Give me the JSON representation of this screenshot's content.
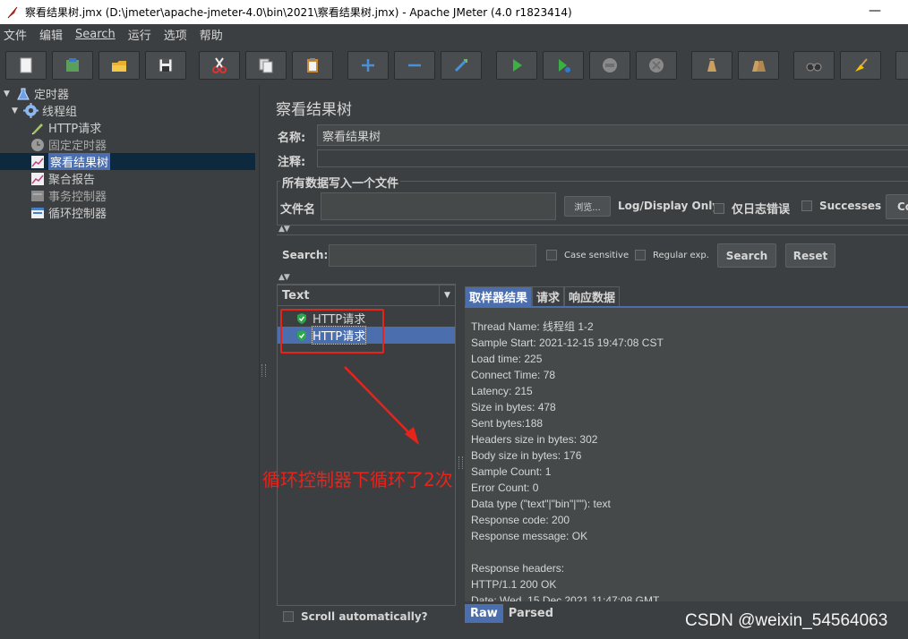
{
  "window": {
    "title": "察看结果树.jmx (D:\\jmeter\\apache-jmeter-4.0\\bin\\2021\\察看结果树.jmx) - Apache JMeter (4.0 r1823414)",
    "minimize_glyph": "—"
  },
  "menu": {
    "items": [
      "文件",
      "编辑",
      "Search",
      "运行",
      "选项",
      "帮助"
    ]
  },
  "toolbar": {
    "buttons": [
      {
        "name": "new-icon"
      },
      {
        "name": "templates-icon"
      },
      {
        "name": "open-icon"
      },
      {
        "name": "save-icon"
      },
      {
        "name": "cut-icon"
      },
      {
        "name": "copy-icon"
      },
      {
        "name": "paste-icon"
      },
      {
        "name": "expand-icon"
      },
      {
        "name": "collapse-icon"
      },
      {
        "name": "toggle-icon"
      },
      {
        "name": "start-icon"
      },
      {
        "name": "start-no-pause-icon"
      },
      {
        "name": "stop-icon"
      },
      {
        "name": "shutdown-icon"
      },
      {
        "name": "clear-icon"
      },
      {
        "name": "clear-all-icon"
      },
      {
        "name": "search-icon"
      },
      {
        "name": "reset-search-icon"
      }
    ]
  },
  "tree": {
    "nodes": [
      {
        "label": "定时器",
        "icon": "test-plan-icon",
        "expanded": true
      },
      {
        "label": "线程组",
        "icon": "thread-group-icon",
        "expanded": true
      },
      {
        "label": "HTTP请求",
        "icon": "sampler-icon"
      },
      {
        "label": "固定定时器",
        "icon": "timer-icon",
        "disabled": true
      },
      {
        "label": "察看结果树",
        "icon": "listener-icon",
        "selected": true
      },
      {
        "label": "聚合报告",
        "icon": "listener-icon"
      },
      {
        "label": "事务控制器",
        "icon": "controller-icon",
        "disabled": true
      },
      {
        "label": "循环控制器",
        "icon": "loop-controller-icon"
      }
    ]
  },
  "panel": {
    "title": "察看结果树",
    "name_label": "名称:",
    "name_value": "察看结果树",
    "comment_label": "注释:",
    "comment_value": "",
    "file_group_title": "所有数据写入一个文件",
    "file_label": "文件名",
    "file_value": "",
    "browse_label": "浏览...",
    "log_display_label": "Log/Display Only:",
    "errors_only_label": "仅日志错误",
    "successes_label": "Successes",
    "configure_label": "Co"
  },
  "search": {
    "label": "Search:",
    "value": "",
    "case_sensitive_label": "Case sensitive",
    "regex_label": "Regular exp.",
    "search_button": "Search",
    "reset_button": "Reset"
  },
  "results": {
    "renderer": "Text",
    "samples": [
      {
        "label": "HTTP请求",
        "status": "success"
      },
      {
        "label": "HTTP请求",
        "status": "success",
        "selected": true
      }
    ],
    "scroll_auto_label": "Scroll automatically?"
  },
  "detail": {
    "tabs": [
      "取样器结果",
      "请求",
      "响应数据"
    ],
    "active_tab": 0,
    "lines": [
      "Thread Name: 线程组 1-2",
      "Sample Start: 2021-12-15 19:47:08 CST",
      "Load time: 225",
      "Connect Time: 78",
      "Latency: 215",
      "Size in bytes: 478",
      "Sent bytes:188",
      "Headers size in bytes: 302",
      "Body size in bytes: 176",
      "Sample Count: 1",
      "Error Count: 0",
      "Data type (\"text\"|\"bin\"|\"\"): text",
      "Response code: 200",
      "Response message: OK",
      "",
      "Response headers:",
      "HTTP/1.1 200 OK",
      "Date: Wed, 15 Dec 2021 11:47:08 GMT"
    ],
    "bottom_tabs": [
      "Raw",
      "Parsed"
    ],
    "bottom_active": 0
  },
  "annotation": {
    "text": "循环控制器下循环了2次",
    "color": "#e8231b"
  },
  "watermark": "CSDN @weixin_54564063"
}
